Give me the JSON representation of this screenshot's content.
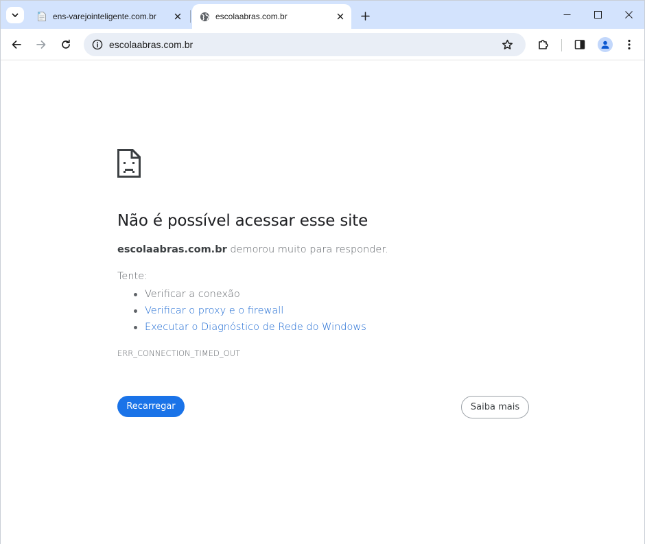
{
  "tabs": [
    {
      "title": "ens-varejointeligente.com.br",
      "active": false,
      "favicon": "page-icon"
    },
    {
      "title": "escolaabras.com.br",
      "active": true,
      "favicon": "globe-icon"
    }
  ],
  "omnibox": {
    "url": "escolaabras.com.br"
  },
  "error": {
    "heading": "Não é possível acessar esse site",
    "domain": "escolaabras.com.br",
    "summary_rest": " demorou muito para responder.",
    "try_label": "Tente:",
    "suggestions": [
      "Verificar a conexão",
      "Verificar o proxy e o firewall",
      "Executar o Diagnóstico de Rede do Windows"
    ],
    "code": "ERR_CONNECTION_TIMED_OUT",
    "reload_label": "Recarregar",
    "learn_more_label": "Saiba mais"
  },
  "colors": {
    "tabstrip": "#d3e3fd",
    "primary_button": "#1a73e8",
    "link": "#1967d2"
  }
}
